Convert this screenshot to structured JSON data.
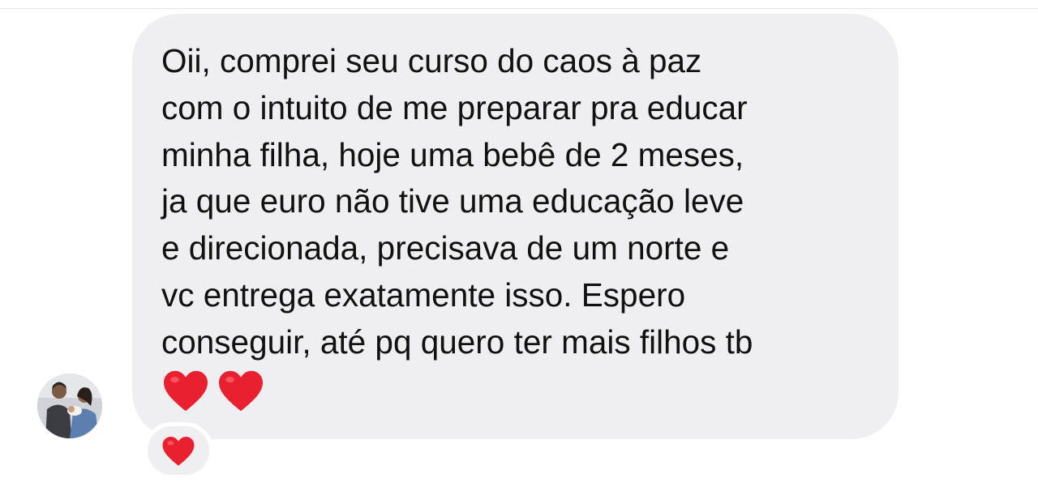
{
  "message": {
    "lines": [
      "Oii, comprei seu curso do caos à paz",
      "com o intuito de me preparar pra educar",
      "minha filha, hoje uma bebê de 2 meses,",
      "ja que euro não tive uma educação leve",
      "e direcionada, precisava de um norte e",
      "vc entrega exatamente isso. Espero",
      "conseguir, até pq quero ter mais filhos tb"
    ],
    "emoji_icons": [
      "heart-icon",
      "heart-icon"
    ]
  },
  "reaction": {
    "icon": "heart-icon"
  },
  "colors": {
    "bubble": "#efeff1",
    "heart": "#e8202f",
    "text": "#111111"
  }
}
